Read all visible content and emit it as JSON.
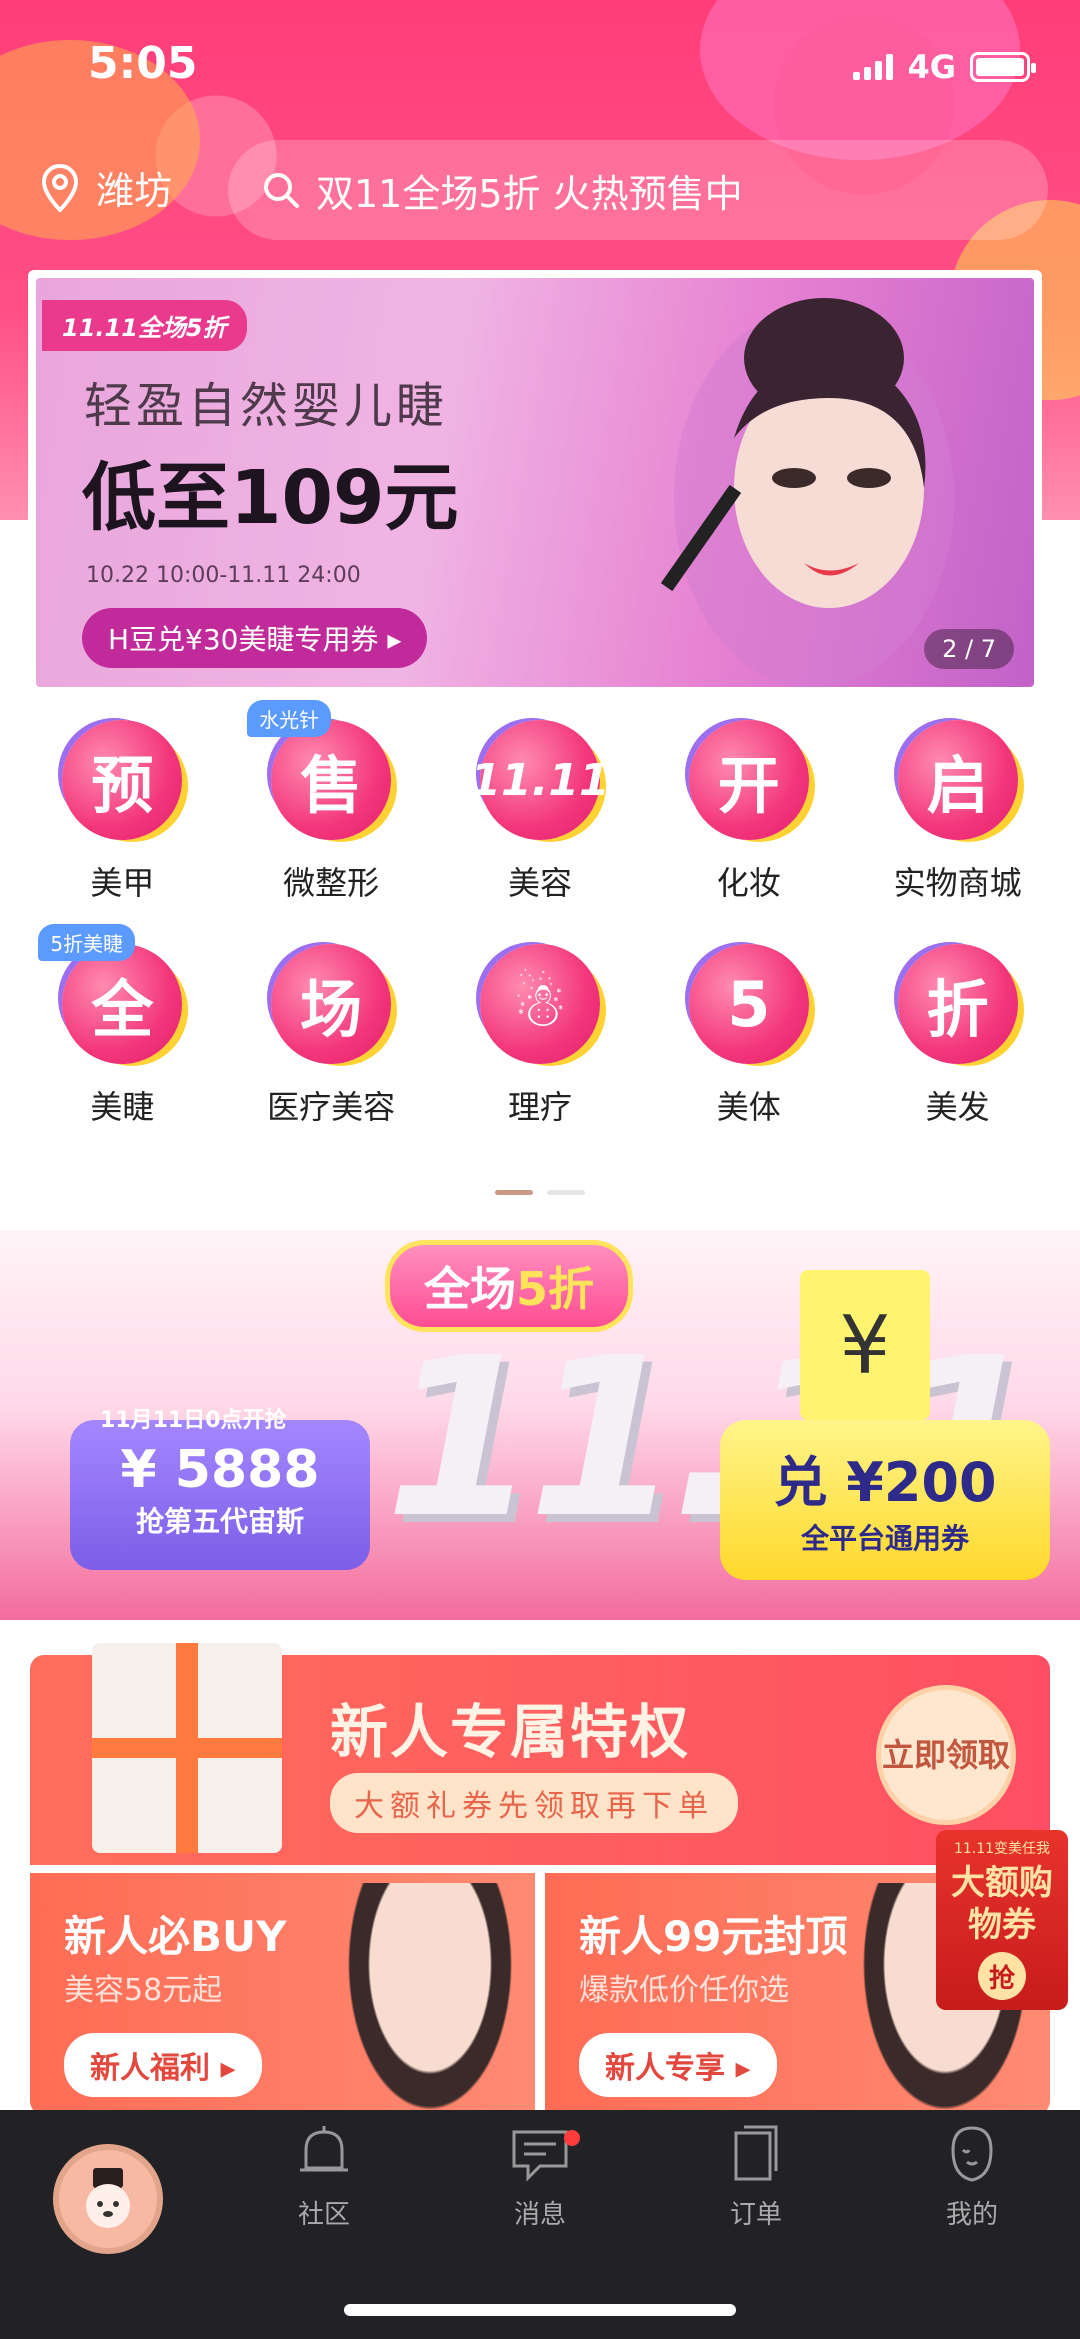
{
  "status": {
    "time": "5:05",
    "network": "4G"
  },
  "header": {
    "location": "潍坊",
    "search_placeholder": "双11全场5折 火热预售中"
  },
  "banner": {
    "tag": "11.11全场5折",
    "subtitle": "轻盈自然婴儿睫",
    "title": "低至109元",
    "date": "10.22 10:00-11.11 24:00",
    "button": "H豆兑¥30美睫专用券 ▸",
    "pager": "2 / 7"
  },
  "grid": {
    "row1": [
      {
        "glyph": "预",
        "label": "美甲",
        "badge": ""
      },
      {
        "glyph": "售",
        "label": "微整形",
        "badge": "水光针"
      },
      {
        "glyph": "11.11",
        "label": "美容",
        "badge": ""
      },
      {
        "glyph": "开",
        "label": "化妆",
        "badge": ""
      },
      {
        "glyph": "启",
        "label": "实物商城",
        "badge": ""
      }
    ],
    "row2": [
      {
        "glyph": "全",
        "label": "美睫",
        "badge": "5折美睫"
      },
      {
        "glyph": "场",
        "label": "医疗美容",
        "badge": ""
      },
      {
        "glyph": "☃",
        "label": "理疗",
        "badge": ""
      },
      {
        "glyph": "5",
        "label": "美体",
        "badge": ""
      },
      {
        "glyph": "折",
        "label": "美发",
        "badge": ""
      }
    ]
  },
  "promo": {
    "title_prefix": "全场",
    "title_highlight": "5折",
    "big_text": "11.11",
    "left_note": "11月11日0点开抢",
    "left_price": "¥ 5888",
    "left_name": "抢第五代宙斯",
    "yen": "¥",
    "right_main": "兑 ¥200",
    "right_sub": "全平台通用券"
  },
  "newuser": {
    "title": "新人专属特权",
    "subtitle": "大额礼券先领取再下单",
    "claim": "立即领取",
    "card_left": {
      "title": "新人必BUY",
      "subtitle": "美容58元起",
      "button": "新人福利 ▸"
    },
    "card_right": {
      "title": "新人99元封顶",
      "subtitle": "爆款低价任你选",
      "button": "新人专享 ▸"
    }
  },
  "coupon_float": {
    "top": "11.11变美任我",
    "main": "大额购物券",
    "button": "抢"
  },
  "tabbar": {
    "tabs": [
      {
        "label": ""
      },
      {
        "label": "社区"
      },
      {
        "label": "消息"
      },
      {
        "label": "订单"
      },
      {
        "label": "我的"
      }
    ]
  },
  "colors": {
    "brand": "#ff3e79",
    "tabbar_bg": "#222226",
    "accent_yellow": "#ffe35a"
  }
}
